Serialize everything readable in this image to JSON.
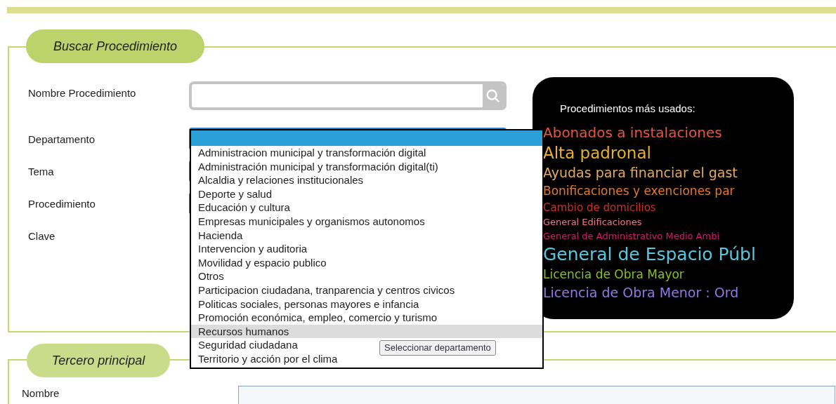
{
  "search_section": {
    "legend": "Buscar Procedimiento",
    "fields": [
      {
        "label": "Nombre Procedimiento",
        "kind": "search"
      },
      {
        "label": "Departamento",
        "kind": "select"
      },
      {
        "label": "Tema",
        "kind": "select"
      },
      {
        "label": "Procedimiento",
        "kind": "select"
      },
      {
        "label": "Clave",
        "kind": "none"
      }
    ]
  },
  "department_dropdown": {
    "blank_option": {
      "selected": true
    },
    "options": [
      {
        "label": "Administracion municipal y transformación digital",
        "selected": false,
        "hovered": false
      },
      {
        "label": "Administración municipal y transformación digital(ti)",
        "selected": false,
        "hovered": false
      },
      {
        "label": "Alcaldia y relaciones institucionales",
        "selected": false,
        "hovered": false
      },
      {
        "label": "Deporte y salud",
        "selected": false,
        "hovered": false
      },
      {
        "label": "Educación y cultura",
        "selected": false,
        "hovered": false
      },
      {
        "label": "Empresas municipales y organismos autonomos",
        "selected": false,
        "hovered": false
      },
      {
        "label": "Hacienda",
        "selected": false,
        "hovered": false
      },
      {
        "label": "Intervencion y auditoria",
        "selected": false,
        "hovered": false
      },
      {
        "label": "Movilidad y espacio publico",
        "selected": false,
        "hovered": false
      },
      {
        "label": "Otros",
        "selected": false,
        "hovered": false
      },
      {
        "label": "Participacion ciudadana, tranparencia y centros civicos",
        "selected": false,
        "hovered": false
      },
      {
        "label": "Politicas sociales, personas mayores e infancia",
        "selected": false,
        "hovered": false
      },
      {
        "label": "Promoción económica, empleo, comercio y turismo",
        "selected": false,
        "hovered": false
      },
      {
        "label": "Recursos humanos",
        "selected": false,
        "hovered": true
      },
      {
        "label": "Seguridad ciudadana",
        "selected": false,
        "hovered": false
      },
      {
        "label": "Territorio y acción por el clima",
        "selected": false,
        "hovered": false
      }
    ],
    "tooltip": "Seleccionar departamento"
  },
  "most_used": {
    "title": "Procedimientos más usados:",
    "items": [
      {
        "label": "Abonados a instalaciones",
        "color": "#e8553e",
        "kind": "l"
      },
      {
        "label": "Alta padronal",
        "color": "#e8b030",
        "kind": "xl"
      },
      {
        "label": "Ayudas para financiar el gast",
        "color": "#e2aa66",
        "kind": "m"
      },
      {
        "label": "Bonificaciones y exenciones par",
        "color": "#e07a2a",
        "kind": "s"
      },
      {
        "label": "Cambio de domicilios",
        "color": "#c8302a",
        "kind": "xs"
      },
      {
        "label": "General Edificaciones",
        "color": "#e87a8a",
        "kind": "xxs"
      },
      {
        "label": "General de Administrativo Medio Ambi",
        "color": "#d81a70",
        "kind": "xxs"
      },
      {
        "label": "General de Espacio Públ",
        "color": "#55c8e0",
        "kind": "xxl"
      },
      {
        "label": "Licencia de Obra Mayor",
        "color": "#8cc020",
        "kind": "s"
      },
      {
        "label": "Licencia de Obra Menor : Ord",
        "color": "#9575e8",
        "kind": "m"
      }
    ]
  },
  "third_party_section": {
    "legend": "Tercero principal",
    "fields": [
      {
        "label": "Nombre"
      }
    ]
  }
}
